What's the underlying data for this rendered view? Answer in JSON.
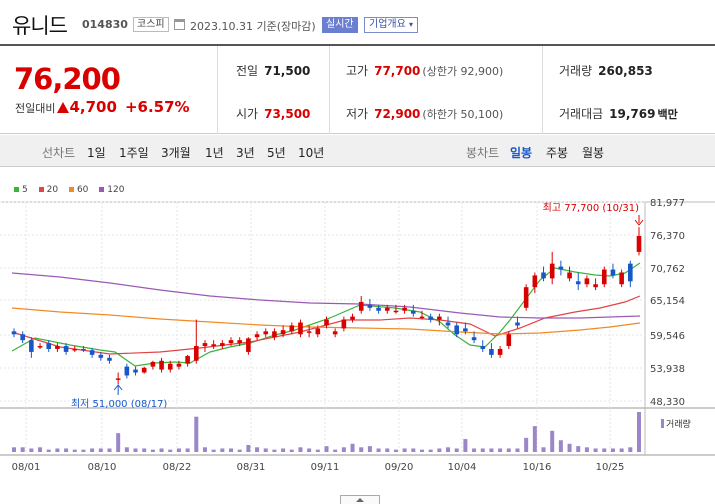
{
  "header": {
    "name": "유니드",
    "code": "014830",
    "market": "코스피",
    "date": "2023.10.31 기준(장마감)",
    "realtime_label": "실시간",
    "corp_info_label": "기업개요"
  },
  "price": {
    "current": "76,200",
    "change_label": "전일대비",
    "change_value": "4,700",
    "change_pct": "+6.57%"
  },
  "stats": {
    "prev_label": "전일",
    "prev_val": "71,500",
    "open_label": "시가",
    "open_val": "73,500",
    "high_label": "고가",
    "high_val": "77,700",
    "high_sub": "(상한가 92,900)",
    "low_label": "저가",
    "low_val": "72,900",
    "low_sub": "(하한가 50,100)",
    "volume_label": "거래량",
    "volume_val": "260,853",
    "amount_label": "거래대금",
    "amount_val": "19,769",
    "amount_unit": "백만"
  },
  "periods": {
    "label": "선차트",
    "items": [
      "1일",
      "1주일",
      "3개월",
      "1년",
      "3년",
      "5년",
      "10년"
    ]
  },
  "candle_types": {
    "label": "봉차트",
    "items": [
      "일봉",
      "주봉",
      "월봉"
    ],
    "active": "일봉"
  },
  "legend": [
    {
      "label": "5",
      "color": "#3bb33b"
    },
    {
      "label": "20",
      "color": "#e24444"
    },
    {
      "label": "60",
      "color": "#f08a24"
    },
    {
      "label": "120",
      "color": "#9b59b6"
    }
  ],
  "colors": {
    "up": "#d90000",
    "down": "#1658c9",
    "volume": "#9b86c9"
  },
  "chart_data": {
    "type": "candlestick",
    "y_ticks": [
      "81,977",
      "76,370",
      "70,762",
      "65,154",
      "59,546",
      "53,938",
      "48,330"
    ],
    "ylim": [
      48330,
      81977
    ],
    "x_ticks": [
      "08/01",
      "08/10",
      "08/22",
      "08/31",
      "09/11",
      "09/20",
      "10/04",
      "10/16",
      "10/25"
    ],
    "max_annotation": "최고 77,700 (10/31)",
    "min_annotation": "최저 51,000 (08/17)",
    "volume_label": "거래량",
    "candles": [
      [
        60000,
        60500,
        59000,
        59500
      ],
      [
        59500,
        60000,
        58000,
        58500
      ],
      [
        58500,
        59000,
        55500,
        56500
      ],
      [
        57500,
        58000,
        57000,
        57500
      ],
      [
        58000,
        58500,
        56500,
        57000
      ],
      [
        57000,
        58000,
        56500,
        57500
      ],
      [
        57500,
        58000,
        56000,
        56500
      ],
      [
        57000,
        57500,
        56500,
        57000
      ],
      [
        57000,
        57500,
        56500,
        56800
      ],
      [
        56800,
        57200,
        55500,
        56000
      ],
      [
        56000,
        56500,
        55000,
        55500
      ],
      [
        55500,
        56000,
        54500,
        55000
      ],
      [
        52000,
        53000,
        51000,
        52000
      ],
      [
        54000,
        54500,
        52000,
        52500
      ],
      [
        53500,
        54000,
        52500,
        53000
      ],
      [
        53000,
        54000,
        52800,
        53800
      ],
      [
        54000,
        55000,
        53500,
        54800
      ],
      [
        53500,
        55500,
        53000,
        55000
      ],
      [
        53500,
        55000,
        53000,
        54500
      ],
      [
        54000,
        55000,
        53500,
        54500
      ],
      [
        54500,
        56000,
        54000,
        55800
      ],
      [
        55000,
        62000,
        54500,
        57500
      ],
      [
        57500,
        58500,
        56500,
        58000
      ],
      [
        57500,
        58500,
        57000,
        57800
      ],
      [
        57500,
        58500,
        57000,
        58000
      ],
      [
        58000,
        59000,
        57500,
        58500
      ],
      [
        58000,
        59000,
        57500,
        58500
      ],
      [
        56500,
        59000,
        56000,
        58800
      ],
      [
        59000,
        60000,
        58500,
        59500
      ],
      [
        59500,
        60500,
        59000,
        60000
      ],
      [
        59000,
        60500,
        58500,
        60000
      ],
      [
        59500,
        61000,
        59000,
        60200
      ],
      [
        60000,
        61500,
        59500,
        61000
      ],
      [
        59500,
        62000,
        59000,
        61500
      ],
      [
        60000,
        61000,
        59000,
        60000
      ],
      [
        59500,
        61000,
        59000,
        60500
      ],
      [
        61000,
        62500,
        60500,
        62000
      ],
      [
        59500,
        60500,
        59000,
        60000
      ],
      [
        60500,
        62500,
        60000,
        62000
      ],
      [
        62000,
        63000,
        61500,
        62500
      ],
      [
        63500,
        66000,
        63000,
        65000
      ],
      [
        64500,
        65500,
        63500,
        64000
      ],
      [
        64000,
        64500,
        63000,
        63500
      ],
      [
        63500,
        64500,
        63000,
        64000
      ],
      [
        63500,
        64500,
        63000,
        63500
      ],
      [
        63500,
        64500,
        63000,
        64000
      ],
      [
        63500,
        64500,
        62500,
        63000
      ],
      [
        62500,
        63500,
        62000,
        62500
      ],
      [
        62500,
        63000,
        61500,
        62000
      ],
      [
        62000,
        63000,
        61000,
        62500
      ],
      [
        61500,
        62500,
        60500,
        61000
      ],
      [
        61000,
        61500,
        59000,
        59500
      ],
      [
        60500,
        61500,
        59500,
        60000
      ],
      [
        59000,
        60000,
        58000,
        58500
      ],
      [
        57500,
        58500,
        56500,
        57000
      ],
      [
        57000,
        58000,
        55500,
        56000
      ],
      [
        56000,
        57500,
        55500,
        57000
      ],
      [
        57500,
        60000,
        57000,
        59500
      ],
      [
        61500,
        62500,
        60500,
        61000
      ],
      [
        64000,
        68000,
        63500,
        67500
      ],
      [
        67500,
        70000,
        66500,
        69500
      ],
      [
        70000,
        71000,
        68500,
        69000
      ],
      [
        69000,
        73500,
        68000,
        71500
      ],
      [
        71000,
        72000,
        69500,
        70500
      ],
      [
        69000,
        71000,
        68500,
        70000
      ],
      [
        68500,
        70000,
        67000,
        68000
      ],
      [
        68000,
        69500,
        67500,
        69000
      ],
      [
        67500,
        69000,
        67000,
        68000
      ],
      [
        68000,
        71000,
        67500,
        70500
      ],
      [
        70500,
        71500,
        69000,
        69500
      ],
      [
        68000,
        70500,
        67500,
        70000
      ],
      [
        71500,
        72000,
        67500,
        68500
      ],
      [
        73500,
        77700,
        72900,
        76200
      ]
    ],
    "volumes": [
      4,
      4,
      3,
      4,
      2,
      3,
      3,
      2,
      2,
      3,
      3,
      3,
      16,
      4,
      3,
      3,
      2,
      3,
      2,
      3,
      3,
      30,
      4,
      2,
      3,
      3,
      2,
      6,
      4,
      3,
      2,
      3,
      2,
      4,
      3,
      2,
      5,
      2,
      4,
      7,
      4,
      5,
      3,
      3,
      2,
      3,
      3,
      2,
      2,
      3,
      4,
      3,
      11,
      3,
      3,
      3,
      3,
      3,
      3,
      12,
      22,
      4,
      18,
      10,
      7,
      5,
      4,
      3,
      3,
      3,
      3,
      4,
      34
    ],
    "ma": {
      "ma5": [
        [
          12,
          351
        ],
        [
          35,
          338
        ],
        [
          70,
          345
        ],
        [
          100,
          350
        ],
        [
          115,
          352
        ],
        [
          135,
          366
        ],
        [
          155,
          363
        ],
        [
          175,
          362
        ],
        [
          190,
          363
        ],
        [
          210,
          352
        ],
        [
          230,
          347
        ],
        [
          250,
          343
        ],
        [
          275,
          335
        ],
        [
          295,
          330
        ],
        [
          330,
          318
        ],
        [
          360,
          305
        ],
        [
          395,
          308
        ],
        [
          420,
          312
        ],
        [
          440,
          322
        ],
        [
          455,
          335
        ],
        [
          470,
          345
        ],
        [
          485,
          347
        ],
        [
          500,
          332
        ],
        [
          510,
          320
        ],
        [
          525,
          300
        ],
        [
          540,
          280
        ],
        [
          555,
          268
        ],
        [
          575,
          272
        ],
        [
          595,
          275
        ],
        [
          610,
          276
        ],
        [
          625,
          273
        ],
        [
          640,
          263
        ]
      ],
      "ma20": [
        [
          12,
          332
        ],
        [
          60,
          347
        ],
        [
          110,
          354
        ],
        [
          160,
          352
        ],
        [
          200,
          348
        ],
        [
          250,
          342
        ],
        [
          300,
          332
        ],
        [
          345,
          320
        ],
        [
          380,
          320
        ],
        [
          410,
          318
        ],
        [
          440,
          320
        ],
        [
          470,
          324
        ],
        [
          495,
          336
        ],
        [
          520,
          328
        ],
        [
          545,
          318
        ],
        [
          575,
          312
        ],
        [
          600,
          308
        ],
        [
          625,
          302
        ],
        [
          640,
          296
        ]
      ],
      "ma60": [
        [
          12,
          308
        ],
        [
          60,
          312
        ],
        [
          110,
          315
        ],
        [
          160,
          319
        ],
        [
          210,
          322
        ],
        [
          260,
          325
        ],
        [
          310,
          327
        ],
        [
          360,
          328
        ],
        [
          410,
          329
        ],
        [
          460,
          332
        ],
        [
          500,
          334
        ],
        [
          540,
          333
        ],
        [
          580,
          330
        ],
        [
          610,
          327
        ],
        [
          640,
          323
        ]
      ],
      "ma120": [
        [
          12,
          273
        ],
        [
          60,
          277
        ],
        [
          110,
          283
        ],
        [
          160,
          290
        ],
        [
          210,
          296
        ],
        [
          260,
          300
        ],
        [
          310,
          303
        ],
        [
          360,
          304
        ],
        [
          410,
          307
        ],
        [
          460,
          313
        ],
        [
          500,
          317
        ],
        [
          540,
          318
        ],
        [
          580,
          318
        ],
        [
          640,
          316
        ]
      ]
    }
  }
}
